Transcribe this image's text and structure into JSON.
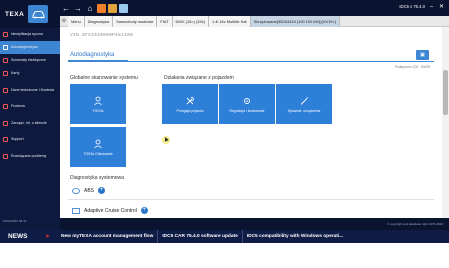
{
  "app": {
    "logo": "TEXA",
    "version": "IDC5 v 75.4.0"
  },
  "sidebar": {
    "items": [
      {
        "label": "Identyfikacja ręczna"
      },
      {
        "label": "Autodiagnostyka"
      },
      {
        "label": "Schematy elektryczne"
      },
      {
        "label": "Karty"
      },
      {
        "label": "Dane techniczne i Kontrola"
      },
      {
        "label": "Pozdrow"
      },
      {
        "label": "Zarządz. inf. o klienciе"
      },
      {
        "label": "Support"
      },
      {
        "label": "Rozwiązane problemy"
      }
    ],
    "timestamp": "15/02/2022 08:41"
  },
  "breadcrumb": {
    "items": [
      "Menu",
      "Diagnostyka",
      "Samochody osobowe",
      "FIAT",
      "500X (15>) (334)",
      "1.4i 16v MultiAir Kat",
      "Skrzyżowane(552A3424 (100 100 kW))(01/15>)"
    ]
  },
  "main": {
    "vin": "VIN ZFA3340000P481400",
    "tab": "Autodiagnostyka",
    "updated": "Podłączono: ID2 - 8/4/09",
    "global_title": "Globalne skanowanie systemu",
    "global_tiles": [
      {
        "label": "TGS3s"
      },
      {
        "label": "TGS3s Odkowanie"
      }
    ],
    "vehicle_title": "Działania związane z pojazdem",
    "vehicle_tiles": [
      {
        "label": "Przegląd pojazdu"
      },
      {
        "label": "Regulacja i kodowanie"
      },
      {
        "label": "Sprawdź. urządzenia"
      }
    ],
    "systems_title": "Diagnostyka systemowa",
    "systems": [
      {
        "label": "ABS"
      },
      {
        "label": "Adaptive Cruise Control"
      }
    ]
  },
  "footer": {
    "copyright": "© copyright and database right 1976-2022"
  },
  "news": {
    "label": "NEWS",
    "items": [
      "New myTEXA account management flow",
      "IDC5 CAR 75.4.0 software update",
      "IDC5 compatibility with Windows operati..."
    ]
  },
  "colors": {
    "accent": "#2e7fd8",
    "dark": "#0d1a3d",
    "news_arrow": "#e03030"
  }
}
